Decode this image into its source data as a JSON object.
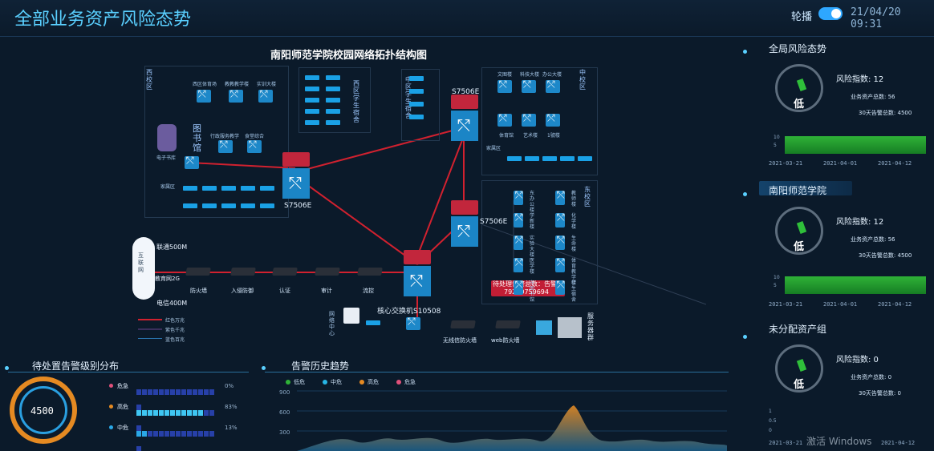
{
  "header": {
    "title": "全部业务资产风险态势",
    "carousel_label": "轮播",
    "datetime": "21/04/20 09:31"
  },
  "topology": {
    "title": "南阳师范学院校园网络拓扑结构图",
    "zones": {
      "west": "西校区",
      "west_dorm": "西区学生宿舍",
      "library": "图书馆",
      "middle_dorm": "中区学生宿舍",
      "middle": "中校区",
      "east": "东校区"
    },
    "small_labels": {
      "west_row1": [
        "西区体育场",
        "教教教学楼",
        "实训大楼"
      ],
      "west_row2": [
        "行政服务教学",
        "食堂综合"
      ],
      "library_server": "电子书库",
      "family_area": "家属区",
      "family_area_mid": "家属区",
      "middle_row1": [
        "文图楼",
        "科技大楼",
        "办公大楼"
      ],
      "middle_row2": [
        "体育馆",
        "艺术楼",
        "1號楼"
      ],
      "east_col1": [
        "东办公楼",
        "学新楼",
        "实验大楼",
        "医学楼",
        "东图书馆"
      ],
      "east_col2": [
        "教师楼",
        "化学楼",
        "生命楼",
        "体育教学楼",
        "学生宿舍"
      ]
    },
    "core_switches": {
      "left": "S7506E",
      "top_right": "S7506E",
      "mid_right": "S7506E",
      "core": "核心交换机S10508"
    },
    "links": {
      "unicom": "联通500M",
      "edu": "教育网2G",
      "telecom": "电信400M",
      "internet": "互联网"
    },
    "devices": [
      "防火墙",
      "入侵防御",
      "认证",
      "审计",
      "流控"
    ],
    "network_center": "网络中心",
    "server_group": "服务器群",
    "waf": "web防火墙",
    "wireless_fw": "无线信防火墙",
    "legend": [
      "红色万兆",
      "紫色千兆",
      "蓝色百兆"
    ],
    "alert": {
      "text": "待处理告警总数：告警",
      "number": "79200759694"
    }
  },
  "alert_levels": {
    "title": "待处置告警级别分布",
    "total": "4500",
    "items": [
      {
        "name": "危急",
        "pct": "0%",
        "color": "#e0507a",
        "fill": 0
      },
      {
        "name": "高危",
        "pct": "83%",
        "color": "#e58a22",
        "fill": 0.83
      },
      {
        "name": "中危",
        "pct": "13%",
        "color": "#2aa7e6",
        "fill": 0.13
      }
    ]
  },
  "history": {
    "title": "告警历史趋势",
    "legend": [
      {
        "name": "低危",
        "color": "#2fb237"
      },
      {
        "name": "中危",
        "color": "#27b6e6"
      },
      {
        "name": "高危",
        "color": "#e58a22"
      },
      {
        "name": "危急",
        "color": "#e0507a"
      }
    ],
    "yticks": [
      "900",
      "600",
      "300",
      "0"
    ]
  },
  "right": {
    "cards": [
      {
        "title": "全局风险态势",
        "risk_label": "风险指数: 12",
        "assets": "业务资产总数: 56",
        "alarms": "30天告警总数: 4500",
        "level": "低",
        "yticks": [
          "10",
          "5"
        ],
        "dates": [
          "2021-03-21",
          "2021-04-01",
          "2021-04-12"
        ]
      },
      {
        "title": "南阳师范学院",
        "risk_label": "风险指数: 12",
        "assets": "业务资产总数: 56",
        "alarms": "30天告警总数: 4500",
        "level": "低",
        "yticks": [
          "10",
          "5"
        ],
        "dates": [
          "2021-03-21",
          "2021-04-01",
          "2021-04-12"
        ]
      },
      {
        "title": "未分配资产组",
        "risk_label": "风险指数: 0",
        "assets": "业务资产总数: 0",
        "alarms": "30天告警总数: 0",
        "level": "低",
        "yticks": [
          "1",
          "0.5",
          "0"
        ],
        "dates": [
          "2021-03-21",
          "2021-04-12"
        ]
      }
    ],
    "gauge_ticks": [
      "0",
      "10",
      "20",
      "30",
      "40",
      "50",
      "60",
      "70",
      "80",
      "90",
      "100"
    ]
  },
  "watermark": "激活 Windows"
}
